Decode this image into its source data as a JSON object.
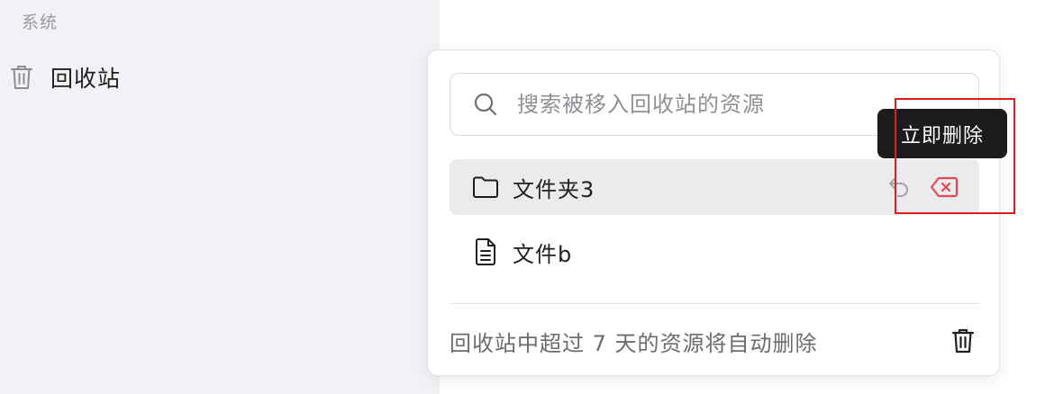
{
  "sidebar": {
    "section_title": "系统",
    "items": [
      {
        "label": "回收站",
        "icon": "trash-icon"
      }
    ]
  },
  "trash_panel": {
    "search": {
      "placeholder": "搜索被移入回收站的资源",
      "value": ""
    },
    "items": [
      {
        "label": "文件夹3",
        "icon": "folder-icon",
        "hovered": true
      },
      {
        "label": "文件b",
        "icon": "file-icon",
        "hovered": false
      }
    ],
    "footer_note": "回收站中超过 7 天的资源将自动删除"
  },
  "tooltip": {
    "text": "立即删除"
  },
  "colors": {
    "sidebar_bg": "#f2f1f6",
    "row_hover_bg": "#ebebee",
    "delete_red": "#e5484d",
    "highlight_red": "#e11b1b",
    "tooltip_bg": "#1c1c1e"
  }
}
